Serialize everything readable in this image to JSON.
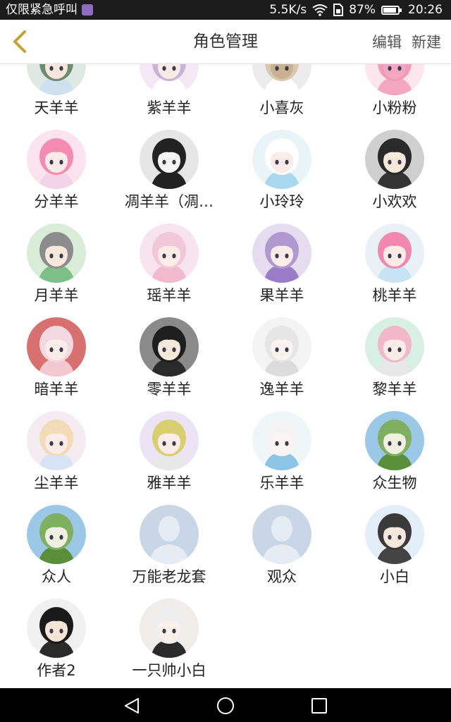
{
  "status_bar": {
    "carrier": "仅限紧急呼叫",
    "speed": "5.5K/s",
    "battery": "87%",
    "time": "20:26"
  },
  "header": {
    "title": "角色管理",
    "edit_label": "编辑",
    "new_label": "新建"
  },
  "characters": [
    {
      "name": "天羊羊",
      "bg": "#dfe9e4",
      "hair": "#6b8e6f",
      "skin": "#f7e6dc",
      "cloth": "#cfe0f0"
    },
    {
      "name": "紫羊羊",
      "bg": "#f3e8f4",
      "hair": "#c8b4d8",
      "skin": "#fbece8",
      "cloth": "#ffffff"
    },
    {
      "name": "小喜灰",
      "bg": "#ececec",
      "hair": "#d8c8b0",
      "skin": "#c8b090",
      "cloth": "#ffffff"
    },
    {
      "name": "小粉粉",
      "bg": "#fde6ee",
      "hair": "#f29ab8",
      "skin": "#f4a7c0",
      "cloth": "#f4a7c0"
    },
    {
      "name": "分羊羊",
      "bg": "#fbe4ee",
      "hair": "#f48bb0",
      "skin": "#fbece8",
      "cloth": "#f2d4e6"
    },
    {
      "name": "凋羊羊（凋…",
      "bg": "#e6e6e6",
      "hair": "#222222",
      "skin": "#f5f5f5",
      "cloth": "#222222"
    },
    {
      "name": "小玲玲",
      "bg": "#e8f4f8",
      "hair": "#ffffff",
      "skin": "#fbece8",
      "cloth": "#a8d8ee"
    },
    {
      "name": "小欢欢",
      "bg": "#cfcfcf",
      "hair": "#2a2a2a",
      "skin": "#f7e8dc",
      "cloth": "#333333"
    },
    {
      "name": "月羊羊",
      "bg": "#d8ecd8",
      "hair": "#8c8c8c",
      "skin": "#f7e8dc",
      "cloth": "#7cc088"
    },
    {
      "name": "瑶羊羊",
      "bg": "#f8e4ee",
      "hair": "#f2c8d8",
      "skin": "#fbece8",
      "cloth": "#f2b8cc"
    },
    {
      "name": "果羊羊",
      "bg": "#e6dcf0",
      "hair": "#b098d0",
      "skin": "#fbece8",
      "cloth": "#9a7cc8"
    },
    {
      "name": "桃羊羊",
      "bg": "#eaf0f8",
      "hair": "#f288b0",
      "skin": "#fbece8",
      "cloth": "#c8e4f4"
    },
    {
      "name": "暗羊羊",
      "bg": "#d87070",
      "hair": "#f2d8e0",
      "skin": "#fbece8",
      "cloth": "#f4c8d0"
    },
    {
      "name": "零羊羊",
      "bg": "#8a8a8a",
      "hair": "#1e1e1e",
      "skin": "#f7e8dc",
      "cloth": "#2a2a2a"
    },
    {
      "name": "逸羊羊",
      "bg": "#f4f4f4",
      "hair": "#e6e6e6",
      "skin": "#fbf4f0",
      "cloth": "#dcdcdc"
    },
    {
      "name": "黎羊羊",
      "bg": "#d8f0e4",
      "hair": "#f2b8c8",
      "skin": "#fbece8",
      "cloth": "#e8e8e8"
    },
    {
      "name": "尘羊羊",
      "bg": "#f4ecf0",
      "hair": "#f2dcb8",
      "skin": "#fbece8",
      "cloth": "#d8e4f4"
    },
    {
      "name": "雅羊羊",
      "bg": "#ece4f4",
      "hair": "#d8d070",
      "skin": "#fbece8",
      "cloth": "#e8e8e8"
    },
    {
      "name": "乐羊羊",
      "bg": "#eef6f8",
      "hair": "#f4f4f4",
      "skin": "#fbf4f0",
      "cloth": "#8cc4e4"
    },
    {
      "name": "众生物",
      "bg": "#9cc8e8",
      "hair": "#7fb060",
      "skin": "#f0f0e0",
      "cloth": "#5a8f3a"
    },
    {
      "name": "众人",
      "bg": "#9cc8e8",
      "hair": "#7fb060",
      "skin": "#f0f0e0",
      "cloth": "#5a8f3a"
    },
    {
      "name": "万能老龙套",
      "bg": "#c9d6e6",
      "hair": "#e6ecf4",
      "skin": "#e6ecf4",
      "cloth": "#e6ecf4"
    },
    {
      "name": "观众",
      "bg": "#c9d6e6",
      "hair": "#e6ecf4",
      "skin": "#e6ecf4",
      "cloth": "#e6ecf4"
    },
    {
      "name": "小白",
      "bg": "#e4eef8",
      "hair": "#3a3a3a",
      "skin": "#f7e8dc",
      "cloth": "#444444"
    },
    {
      "name": "作者2",
      "bg": "#f0f0f0",
      "hair": "#1a1a1a",
      "skin": "#f7e6d8",
      "cloth": "#2a2a2a"
    },
    {
      "name": "一只帅小白",
      "bg": "#f0ece8",
      "hair": "#eeeeee",
      "skin": "#fbf0ea",
      "cloth": "#2a2a2a"
    }
  ],
  "icons": {
    "back": "chevron-left-icon",
    "nav_back": "triangle-back-icon",
    "nav_home": "circle-home-icon",
    "nav_recent": "square-recent-icon"
  },
  "colors": {
    "accent": "#c8a030",
    "status_bar": "#1c1c1c",
    "nav_bar": "#000000"
  }
}
